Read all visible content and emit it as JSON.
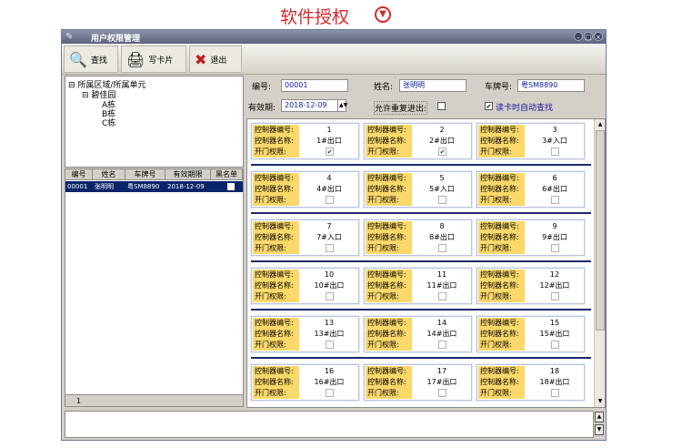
{
  "banner": {
    "title": "软件授权",
    "icon": "chevron-down-circle-icon"
  },
  "window": {
    "title": "用户权限管理",
    "buttons": [
      "minimize",
      "maximize",
      "close"
    ]
  },
  "toolbar": {
    "find_label": "查找",
    "write_card_label": "写卡片",
    "exit_label": "退出"
  },
  "tree": {
    "root": "所属区域/所属单元",
    "group": "碧佳园",
    "items": [
      "A栋",
      "B栋",
      "C栋"
    ]
  },
  "grid": {
    "headers": [
      "编号",
      "姓名",
      "车牌号",
      "有效期限",
      "黑名单"
    ],
    "rows": [
      {
        "id": "00001",
        "name": "张明明",
        "plate": "粤SM8890",
        "expiry": "2018-12-09"
      }
    ],
    "page": "1"
  },
  "form": {
    "id_label": "编号:",
    "id_value": "00001",
    "name_label": "姓名:",
    "name_value": "张明明",
    "plate_label": "车牌号:",
    "plate_value": "粤SM8890",
    "expiry_label": "有效期:",
    "expiry_value": "2018-12-09",
    "repeat_label": "允许重复进出:",
    "auto_label": "读卡时自动查找"
  },
  "card_labels": {
    "ctrl_no": "控制器编号:",
    "ctrl_name": "控制器名称:",
    "permission": "开门权限:"
  },
  "controllers": [
    {
      "no": "1",
      "name": "1#出口",
      "checked": true
    },
    {
      "no": "2",
      "name": "2#出口",
      "checked": true
    },
    {
      "no": "3",
      "name": "3#入口",
      "checked": false
    },
    {
      "no": "4",
      "name": "4#出口",
      "checked": false
    },
    {
      "no": "5",
      "name": "5#入口",
      "checked": false
    },
    {
      "no": "6",
      "name": "6#出口",
      "checked": false
    },
    {
      "no": "7",
      "name": "7#入口",
      "checked": false
    },
    {
      "no": "8",
      "name": "8#出口",
      "checked": false
    },
    {
      "no": "9",
      "name": "9#出口",
      "checked": false
    },
    {
      "no": "10",
      "name": "10#出口",
      "checked": false
    },
    {
      "no": "11",
      "name": "11#出口",
      "checked": false
    },
    {
      "no": "12",
      "name": "12#出口",
      "checked": false
    },
    {
      "no": "13",
      "name": "13#出口",
      "checked": false
    },
    {
      "no": "14",
      "name": "14#出口",
      "checked": false
    },
    {
      "no": "15",
      "name": "15#出口",
      "checked": false
    },
    {
      "no": "16",
      "name": "16#出口",
      "checked": false
    },
    {
      "no": "17",
      "name": "17#出口",
      "checked": false
    },
    {
      "no": "18",
      "name": "18#出口",
      "checked": false
    }
  ]
}
